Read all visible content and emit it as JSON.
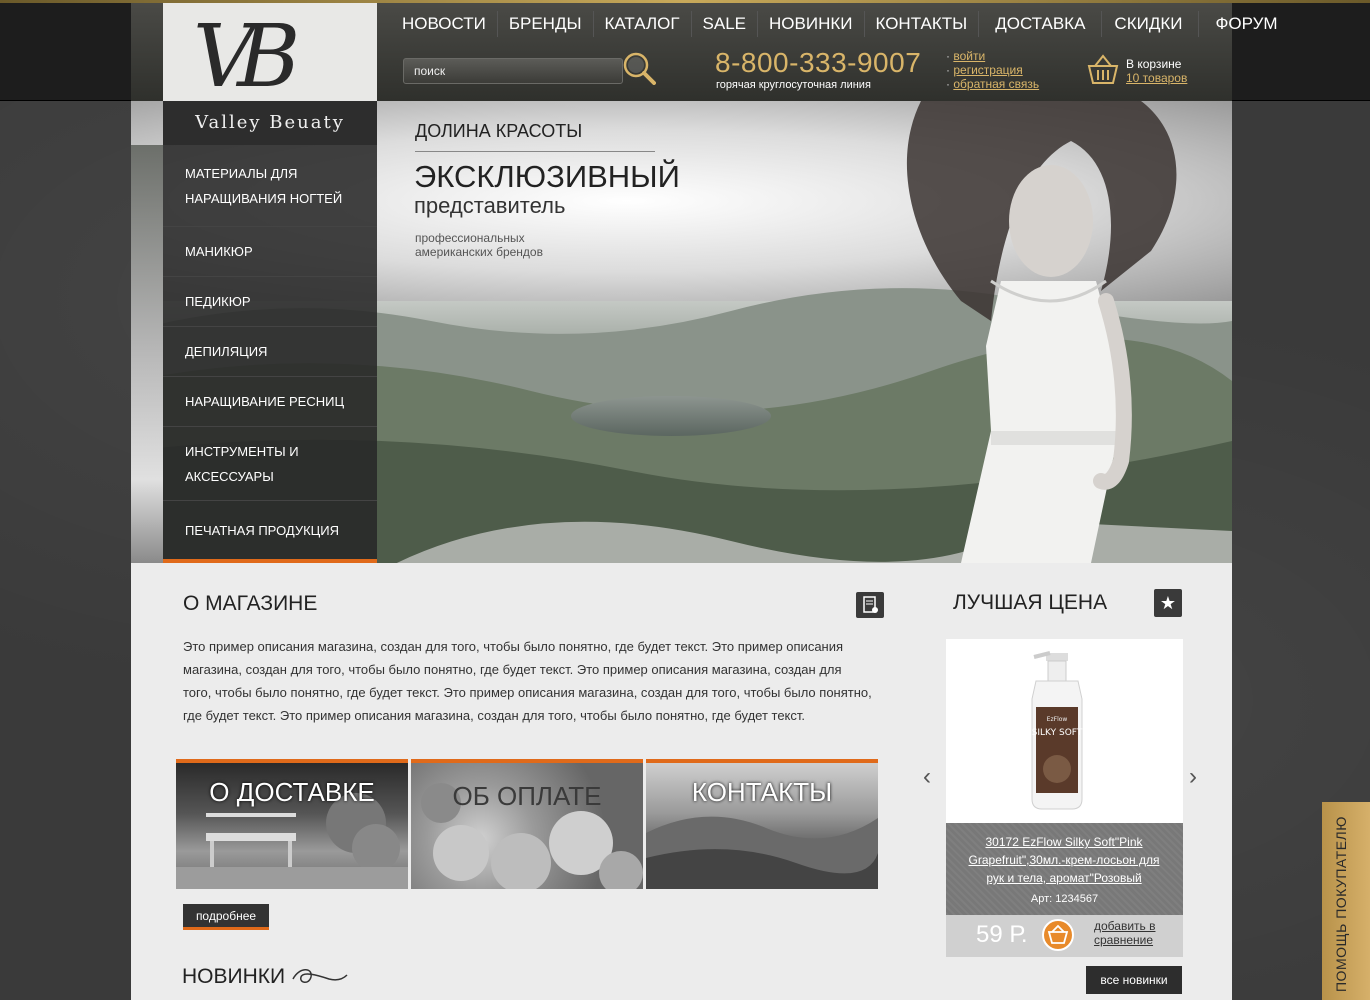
{
  "brand": {
    "monogram": "VB",
    "name": "Valley Beuaty"
  },
  "nav": [
    "НОВОСТИ",
    "БРЕНДЫ",
    "КАТАЛОГ",
    "SALE",
    "НОВИНКИ",
    "КОНТАКТЫ",
    "ДОСТАВКА",
    "СКИДКИ",
    "ФОРУМ"
  ],
  "search": {
    "placeholder": "поиск"
  },
  "phone": {
    "number": "8-800-333-9007",
    "caption": "горячая круглосуточная линия"
  },
  "user_links": [
    "войти",
    "регистрация",
    "обратная связь"
  ],
  "cart": {
    "label": "В корзине",
    "count": "10 товаров"
  },
  "hero": {
    "heading": "ДОЛИНА КРАСОТЫ",
    "line1": "ЭКСКЛЮЗИВНЫЙ",
    "line2": "представитель",
    "sub": "профессиональных американских брендов"
  },
  "sidebar": [
    "МАТЕРИАЛЫ ДЛЯ НАРАЩИВАНИЯ НОГТЕЙ",
    "МАНИКЮР",
    "ПЕДИКЮР",
    "ДЕПИЛЯЦИЯ",
    "НАРАЩИВАНИЕ РЕСНИЦ",
    "ИНСТРУМЕНТЫ И АКСЕССУАРЫ",
    "ПЕЧАТНАЯ ПРОДУКЦИЯ"
  ],
  "about": {
    "title": "О МАГАЗИНЕ",
    "text": "Это пример описания магазина, создан для того, чтобы было понятно, где будет текст. Это пример описания магазина, создан для того, чтобы было понятно, где будет текст. Это пример описания магазина, создан для того, чтобы было понятно, где будет текст. Это пример описания магазина, создан для того, чтобы было понятно, где будет текст. Это пример описания магазина, создан для того, чтобы было понятно, где будет текст.",
    "more": "подробнее"
  },
  "tiles": [
    "О ДОСТАВКЕ",
    "ОБ ОПЛАТЕ",
    "КОНТАКТЫ"
  ],
  "best_price": {
    "title": "ЛУЧШАЯ ЦЕНА",
    "product_name": "30172 EzFlow Silky Soft\"Pink Grapefruit\",30мл.-крем-лосьон для рук и тела, аромат\"Розовый",
    "article": "Арт: 1234567",
    "price": "59 Р.",
    "compare": "добавить в сравнение",
    "bottle_brand": "EzFlow",
    "bottle_label": "SILKY SOFT"
  },
  "new_items": {
    "title": "НОВИНКИ",
    "all": "все новинки"
  },
  "help": "ПОМОЩЬ ПОКУПАТЕЛЮ",
  "colors": {
    "accent": "#e06a1a",
    "gold": "#d9b569"
  }
}
